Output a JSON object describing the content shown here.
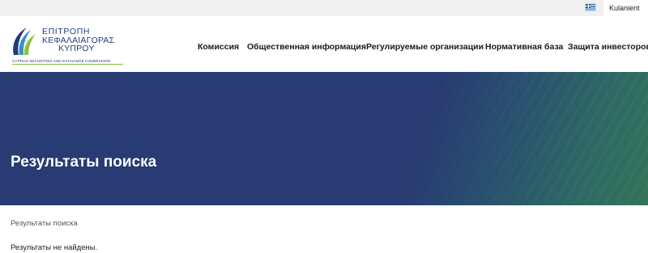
{
  "topbar": {
    "language_flag": "greek-flag-icon",
    "user_label": "Kulanient"
  },
  "logo": {
    "greek_line1": "ΕΠΙΤΡΟΠΗ",
    "greek_line2": "ΚΕΦΑΛΑΙΑΓΟΡΑΣ",
    "greek_line3": "ΚΥΠΡΟΥ",
    "english_line": "CYPRUS SECURITIES AND EXCHANGE COMMISSION"
  },
  "nav": {
    "items": [
      {
        "label": "Комиссия"
      },
      {
        "label": "Общественная информация"
      },
      {
        "label": "Регулируемые организации"
      },
      {
        "label": "Нормативная база"
      },
      {
        "label": "Защита инвесторов"
      }
    ]
  },
  "hero": {
    "title": "Результаты поиска"
  },
  "breadcrumb": {
    "current": "Результаты поиска"
  },
  "results": {
    "message": "Результаты не найдены."
  },
  "colors": {
    "hero_blue": "#283b72",
    "hero_green": "#337559",
    "brand_navy": "#1f3d7a",
    "brand_green": "#8fbf3a"
  }
}
